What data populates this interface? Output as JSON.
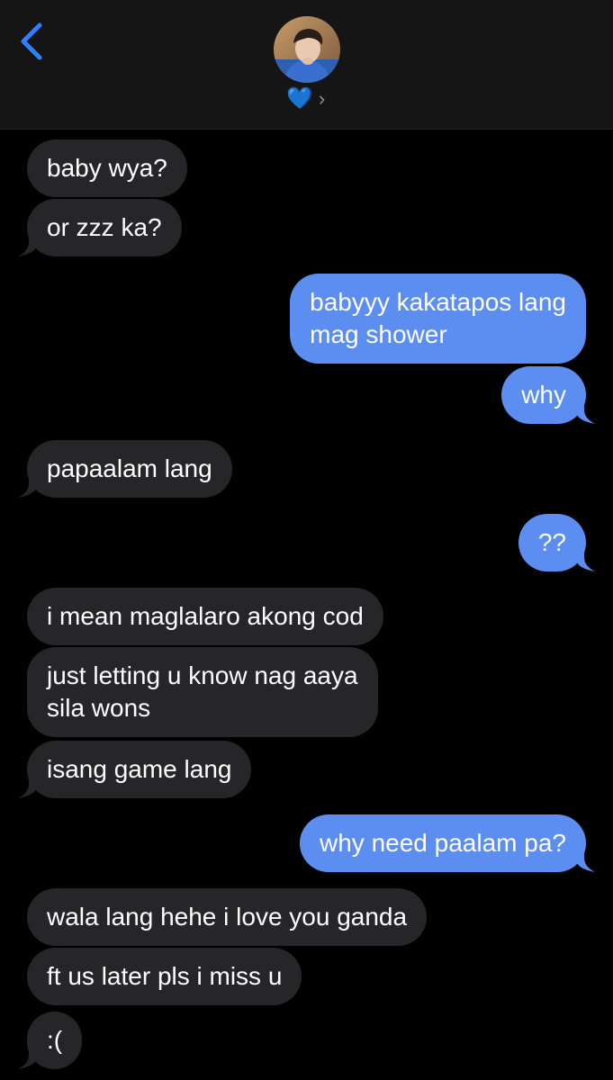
{
  "header": {
    "back_label": "<",
    "contact_name": "💙",
    "chevron": "›"
  },
  "colors": {
    "sent_bubble": "#5b8ef0",
    "received_bubble": "#262628",
    "accent": "#2f80ff",
    "header_bg": "#151515"
  },
  "messages": [
    {
      "direction": "received",
      "text": "baby wya?"
    },
    {
      "direction": "received",
      "text": "or zzz ka?"
    },
    {
      "direction": "sent",
      "lines": [
        "babyyy kakatapos lang",
        "mag shower"
      ]
    },
    {
      "direction": "sent",
      "text": "why"
    },
    {
      "direction": "received",
      "text": "papaalam lang"
    },
    {
      "direction": "sent",
      "text": "??"
    },
    {
      "direction": "received",
      "text": "i mean maglalaro akong cod"
    },
    {
      "direction": "received",
      "lines": [
        "just letting u know nag aaya",
        "sila wons"
      ]
    },
    {
      "direction": "received",
      "text": "isang game lang"
    },
    {
      "direction": "sent",
      "text": "why need paalam pa?"
    },
    {
      "direction": "received",
      "text": "wala lang hehe i love you ganda"
    },
    {
      "direction": "received",
      "text": "ft us later pls i miss u"
    },
    {
      "direction": "received",
      "text": ":("
    }
  ]
}
